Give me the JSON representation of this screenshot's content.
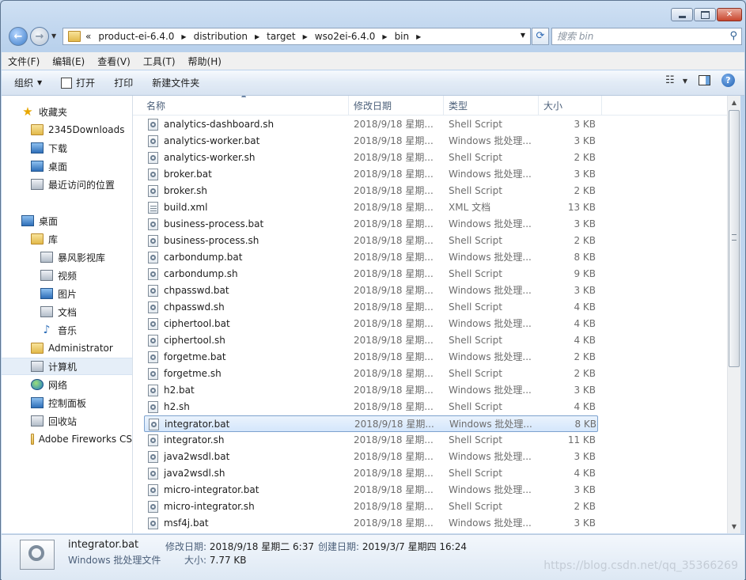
{
  "address": {
    "overflow": "«",
    "crumbs": [
      "product-ei-6.4.0",
      "distribution",
      "target",
      "wso2ei-6.4.0",
      "bin"
    ]
  },
  "search": {
    "placeholder": "搜索 bin"
  },
  "menu": [
    "文件(F)",
    "编辑(E)",
    "查看(V)",
    "工具(T)",
    "帮助(H)"
  ],
  "toolbar": {
    "organize": "组织",
    "open": "打开",
    "print": "打印",
    "new_folder": "新建文件夹"
  },
  "nav": [
    {
      "label": "收藏夹",
      "icon": "star-icon"
    },
    {
      "label": "2345Downloads",
      "icon": "folder-icon"
    },
    {
      "label": "下载",
      "icon": "download-folder-icon"
    },
    {
      "label": "桌面",
      "icon": "desktop-icon"
    },
    {
      "label": "最近访问的位置",
      "icon": "recent-places-icon"
    },
    {
      "label": "桌面",
      "icon": "desktop-icon"
    },
    {
      "label": "库",
      "icon": "library-icon"
    },
    {
      "label": "暴风影视库",
      "icon": "video-library-icon"
    },
    {
      "label": "视频",
      "icon": "videos-icon"
    },
    {
      "label": "图片",
      "icon": "pictures-icon"
    },
    {
      "label": "文档",
      "icon": "documents-icon"
    },
    {
      "label": "音乐",
      "icon": "music-icon"
    },
    {
      "label": "Administrator",
      "icon": "user-folder-icon"
    },
    {
      "label": "计算机",
      "icon": "computer-icon"
    },
    {
      "label": "网络",
      "icon": "network-icon"
    },
    {
      "label": "控制面板",
      "icon": "control-panel-icon"
    },
    {
      "label": "回收站",
      "icon": "recycle-bin-icon"
    },
    {
      "label": "Adobe Fireworks CS",
      "icon": "folder-icon"
    }
  ],
  "columns": {
    "name": "名称",
    "date": "修改日期",
    "type": "类型",
    "size": "大小"
  },
  "files": [
    {
      "name": "analytics-dashboard.sh",
      "date": "2018/9/18 星期...",
      "type": "Shell Script",
      "size": "3 KB"
    },
    {
      "name": "analytics-worker.bat",
      "date": "2018/9/18 星期...",
      "type": "Windows 批处理...",
      "size": "3 KB"
    },
    {
      "name": "analytics-worker.sh",
      "date": "2018/9/18 星期...",
      "type": "Shell Script",
      "size": "2 KB"
    },
    {
      "name": "broker.bat",
      "date": "2018/9/18 星期...",
      "type": "Windows 批处理...",
      "size": "3 KB"
    },
    {
      "name": "broker.sh",
      "date": "2018/9/18 星期...",
      "type": "Shell Script",
      "size": "2 KB"
    },
    {
      "name": "build.xml",
      "date": "2018/9/18 星期...",
      "type": "XML 文档",
      "size": "13 KB"
    },
    {
      "name": "business-process.bat",
      "date": "2018/9/18 星期...",
      "type": "Windows 批处理...",
      "size": "3 KB"
    },
    {
      "name": "business-process.sh",
      "date": "2018/9/18 星期...",
      "type": "Shell Script",
      "size": "2 KB"
    },
    {
      "name": "carbondump.bat",
      "date": "2018/9/18 星期...",
      "type": "Windows 批处理...",
      "size": "8 KB"
    },
    {
      "name": "carbondump.sh",
      "date": "2018/9/18 星期...",
      "type": "Shell Script",
      "size": "9 KB"
    },
    {
      "name": "chpasswd.bat",
      "date": "2018/9/18 星期...",
      "type": "Windows 批处理...",
      "size": "3 KB"
    },
    {
      "name": "chpasswd.sh",
      "date": "2018/9/18 星期...",
      "type": "Shell Script",
      "size": "4 KB"
    },
    {
      "name": "ciphertool.bat",
      "date": "2018/9/18 星期...",
      "type": "Windows 批处理...",
      "size": "4 KB"
    },
    {
      "name": "ciphertool.sh",
      "date": "2018/9/18 星期...",
      "type": "Shell Script",
      "size": "4 KB"
    },
    {
      "name": "forgetme.bat",
      "date": "2018/9/18 星期...",
      "type": "Windows 批处理...",
      "size": "2 KB"
    },
    {
      "name": "forgetme.sh",
      "date": "2018/9/18 星期...",
      "type": "Shell Script",
      "size": "2 KB"
    },
    {
      "name": "h2.bat",
      "date": "2018/9/18 星期...",
      "type": "Windows 批处理...",
      "size": "3 KB"
    },
    {
      "name": "h2.sh",
      "date": "2018/9/18 星期...",
      "type": "Shell Script",
      "size": "4 KB"
    },
    {
      "name": "integrator.bat",
      "date": "2018/9/18 星期...",
      "type": "Windows 批处理...",
      "size": "8 KB",
      "selected": true
    },
    {
      "name": "integrator.sh",
      "date": "2018/9/18 星期...",
      "type": "Shell Script",
      "size": "11 KB"
    },
    {
      "name": "java2wsdl.bat",
      "date": "2018/9/18 星期...",
      "type": "Windows 批处理...",
      "size": "3 KB"
    },
    {
      "name": "java2wsdl.sh",
      "date": "2018/9/18 星期...",
      "type": "Shell Script",
      "size": "4 KB"
    },
    {
      "name": "micro-integrator.bat",
      "date": "2018/9/18 星期...",
      "type": "Windows 批处理...",
      "size": "3 KB"
    },
    {
      "name": "micro-integrator.sh",
      "date": "2018/9/18 星期...",
      "type": "Shell Script",
      "size": "2 KB"
    },
    {
      "name": "msf4j.bat",
      "date": "2018/9/18 星期...",
      "type": "Windows 批处理...",
      "size": "3 KB"
    }
  ],
  "details": {
    "name": "integrator.bat",
    "kind": "Windows 批处理文件",
    "modified_label": "修改日期:",
    "modified": "2018/9/18 星期二 6:37",
    "created_label": "创建日期:",
    "created": "2019/3/7 星期四 16:24",
    "size_label": "大小:",
    "size": "7.77 KB"
  },
  "watermark": "https://blog.csdn.net/qq_35366269"
}
